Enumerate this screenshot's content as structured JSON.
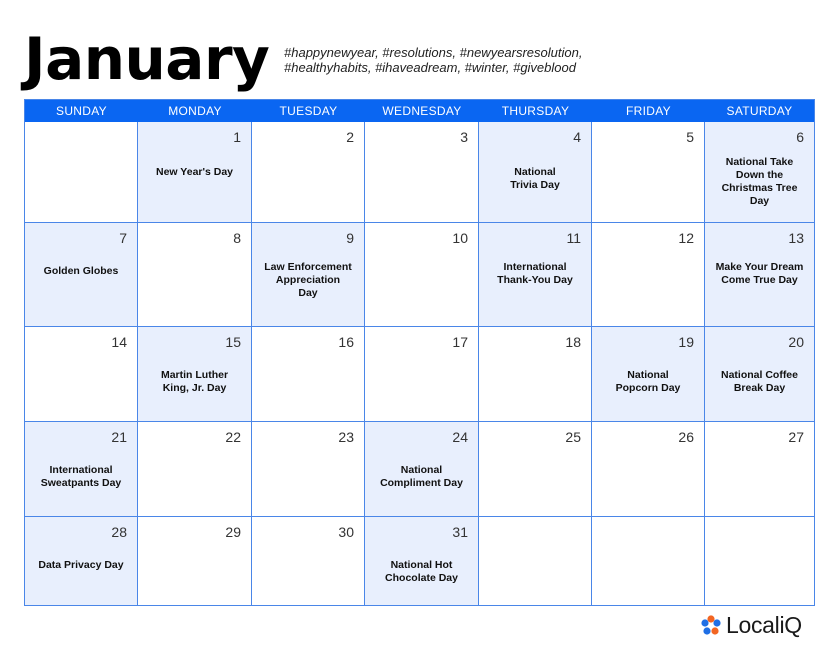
{
  "month": "January",
  "hashtags_line1": "#happynewyear, #resolutions, #newyearsresolution,",
  "hashtags_line2": "#healthyhabits, #ihaveadream, #winter, #giveblood",
  "weekdays": [
    "SUNDAY",
    "MONDAY",
    "TUESDAY",
    "WEDNESDAY",
    "THURSDAY",
    "FRIDAY",
    "SATURDAY"
  ],
  "colors": {
    "header_bg": "#0a66f2",
    "grid_line": "#4a86e8",
    "highlight_cell": "#e8effd",
    "logo_orange": "#f26522",
    "logo_blue": "#1f6fe5"
  },
  "weeks": [
    [
      {
        "day": "",
        "event": "",
        "highlight": false
      },
      {
        "day": "1",
        "event": "New Year's Day",
        "highlight": true
      },
      {
        "day": "2",
        "event": "",
        "highlight": false
      },
      {
        "day": "3",
        "event": "",
        "highlight": false
      },
      {
        "day": "4",
        "event": "National\nTrivia Day",
        "highlight": true
      },
      {
        "day": "5",
        "event": "",
        "highlight": false
      },
      {
        "day": "6",
        "event": "National Take\nDown the\nChristmas Tree\nDay",
        "highlight": true
      }
    ],
    [
      {
        "day": "7",
        "event": "Golden Globes",
        "highlight": true
      },
      {
        "day": "8",
        "event": "",
        "highlight": false
      },
      {
        "day": "9",
        "event": "Law Enforcement\nAppreciation\nDay",
        "highlight": true
      },
      {
        "day": "10",
        "event": "",
        "highlight": false
      },
      {
        "day": "11",
        "event": "International\nThank-You Day",
        "highlight": true
      },
      {
        "day": "12",
        "event": "",
        "highlight": false
      },
      {
        "day": "13",
        "event": "Make Your Dream\nCome True Day",
        "highlight": true
      }
    ],
    [
      {
        "day": "14",
        "event": "",
        "highlight": false
      },
      {
        "day": "15",
        "event": "Martin Luther\nKing, Jr. Day",
        "highlight": true
      },
      {
        "day": "16",
        "event": "",
        "highlight": false
      },
      {
        "day": "17",
        "event": "",
        "highlight": false
      },
      {
        "day": "18",
        "event": "",
        "highlight": false
      },
      {
        "day": "19",
        "event": "National\nPopcorn Day",
        "highlight": true
      },
      {
        "day": "20",
        "event": "National Coffee\nBreak Day",
        "highlight": true
      }
    ],
    [
      {
        "day": "21",
        "event": "International\nSweatpants Day",
        "highlight": true
      },
      {
        "day": "22",
        "event": "",
        "highlight": false
      },
      {
        "day": "23",
        "event": "",
        "highlight": false
      },
      {
        "day": "24",
        "event": "National\nCompliment Day",
        "highlight": true
      },
      {
        "day": "25",
        "event": "",
        "highlight": false
      },
      {
        "day": "26",
        "event": "",
        "highlight": false
      },
      {
        "day": "27",
        "event": "",
        "highlight": false
      }
    ],
    [
      {
        "day": "28",
        "event": "Data Privacy Day",
        "highlight": true
      },
      {
        "day": "29",
        "event": "",
        "highlight": false
      },
      {
        "day": "30",
        "event": "",
        "highlight": false
      },
      {
        "day": "31",
        "event": "National Hot\nChocolate Day",
        "highlight": true
      },
      {
        "day": "",
        "event": "",
        "highlight": false
      },
      {
        "day": "",
        "event": "",
        "highlight": false
      },
      {
        "day": "",
        "event": "",
        "highlight": false
      }
    ]
  ],
  "logo": {
    "text": "LocaliQ",
    "icon": "asterisk-flower-icon"
  }
}
